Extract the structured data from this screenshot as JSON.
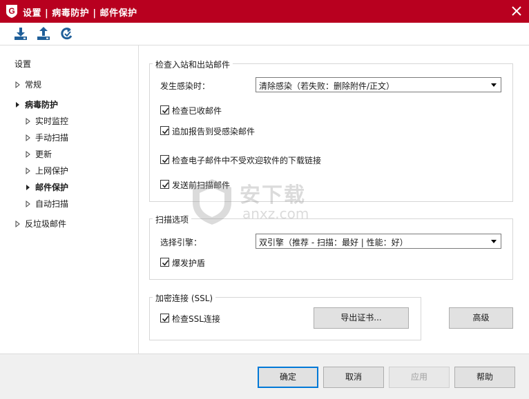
{
  "window": {
    "title": "设置 | 病毒防护 | 邮件保护",
    "logo_letter": "G",
    "title_bar_color": "#b8001f"
  },
  "toolbar": {
    "buttons": [
      {
        "icon": "import-icon"
      },
      {
        "icon": "export-icon"
      },
      {
        "icon": "restore-icon"
      }
    ]
  },
  "sidebar": {
    "heading": "设置",
    "items": [
      {
        "label": "常规"
      },
      {
        "label": "病毒防护"
      },
      {
        "label": "实时监控"
      },
      {
        "label": "手动扫描"
      },
      {
        "label": "更新"
      },
      {
        "label": "上网保护"
      },
      {
        "label": "邮件保护"
      },
      {
        "label": "自动扫描"
      },
      {
        "label": "反垃圾邮件"
      }
    ]
  },
  "inbound": {
    "group_title": "检查入站和出站邮件",
    "infection_label": "发生感染时：",
    "infection_value": "清除感染（若失败：删除附件/正文）",
    "checkboxes": [
      {
        "label": "检查已收邮件",
        "checked": true
      },
      {
        "label": "追加报告到受感染邮件",
        "checked": true
      },
      {
        "label": "检查电子邮件中不受欢迎软件的下载链接",
        "checked": true
      },
      {
        "label": "发送前扫描邮件",
        "checked": true
      }
    ]
  },
  "scan_options": {
    "group_title": "扫描选项",
    "engine_label": "选择引擎：",
    "engine_value": "双引擎（推荐 - 扫描：最好 | 性能：好）",
    "outbreak_label": "爆发护盾",
    "outbreak_checked": true
  },
  "ssl": {
    "group_title": "加密连接 (SSL)",
    "check_label": "检查SSL连接",
    "check_checked": true,
    "export_label": "导出证书...",
    "advanced_label": "高级"
  },
  "footer": {
    "ok": "确定",
    "cancel": "取消",
    "apply": "应用",
    "help": "帮助"
  },
  "watermark": {
    "text": "安下载",
    "sub": "anxz.com"
  }
}
